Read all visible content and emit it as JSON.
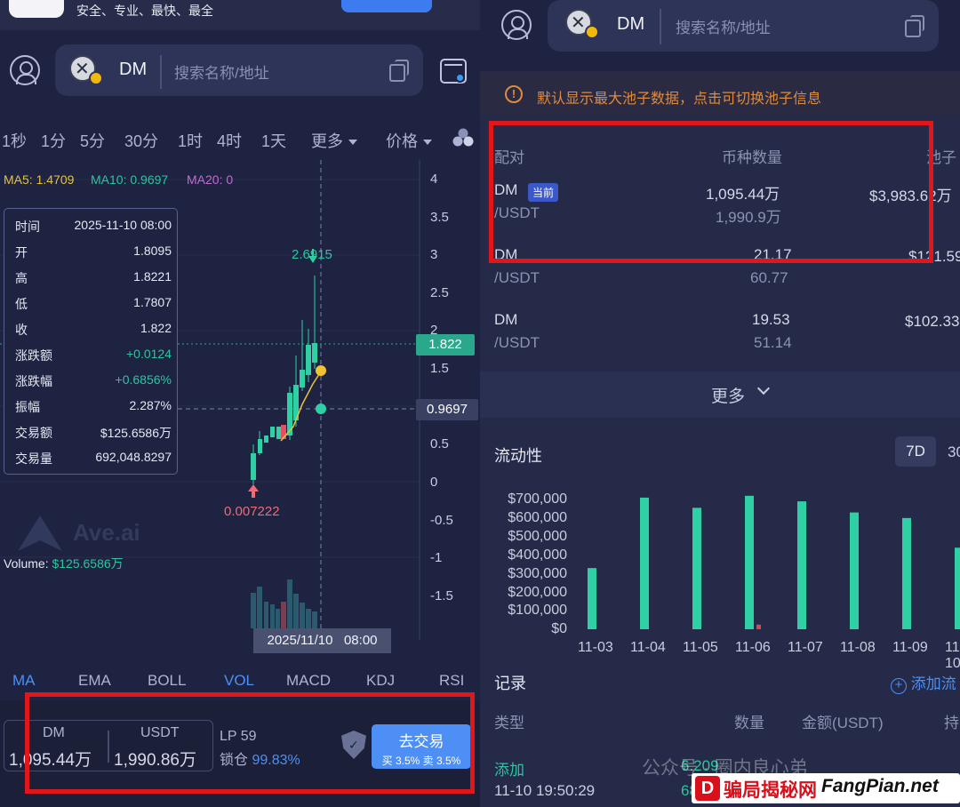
{
  "left": {
    "tagline": "安全、专业、最快、最全",
    "search": {
      "symbol": "DM",
      "placeholder": "搜索名称/地址"
    },
    "timeframes": [
      "1秒",
      "1分",
      "5分",
      "30分",
      "1时",
      "4时",
      "1天"
    ],
    "more_label": "更多",
    "price_label": "价格",
    "ma": {
      "ma5": "MA5: 1.4709",
      "ma10": "MA10: 0.9697",
      "ma20": "MA20: 0"
    },
    "y_axis": [
      "4",
      "3.5",
      "3",
      "2.5",
      "2",
      "1.5",
      "1",
      "0.5",
      "0",
      "-0.5",
      "-1",
      "-1.5"
    ],
    "tooltip": [
      {
        "k": "时间",
        "v": "2025-11-10 08:00"
      },
      {
        "k": "开",
        "v": "1.8095"
      },
      {
        "k": "高",
        "v": "1.8221"
      },
      {
        "k": "低",
        "v": "1.7807"
      },
      {
        "k": "收",
        "v": "1.822"
      },
      {
        "k": "涨跌额",
        "v": "+0.0124"
      },
      {
        "k": "涨跌幅",
        "v": "+0.6856%"
      },
      {
        "k": "振幅",
        "v": "2.287%"
      },
      {
        "k": "交易额",
        "v": "$125.6586万"
      },
      {
        "k": "交易量",
        "v": "692,048.8297"
      }
    ],
    "high_marker": "2.6915",
    "low_marker": "0.007222",
    "price_current": "1.822",
    "price_ma": "0.9697",
    "volume_label": "Volume:",
    "volume_value": "$125.6586万",
    "watermark": "Ave.ai",
    "crosshair_date": "2025/11/10",
    "crosshair_time": "08:00",
    "indicators": [
      "MA",
      "EMA",
      "BOLL",
      "VOL",
      "MACD",
      "KDJ",
      "RSI"
    ],
    "pair": {
      "base": "DM",
      "quote": "USDT",
      "base_amount": "1,095.44万",
      "quote_amount": "1,990.86万"
    },
    "lp": {
      "label": "LP 59",
      "lock_label": "锁仓",
      "lock_value": "99.83%"
    },
    "trade": {
      "label": "去交易",
      "fees": "买 3.5% 卖 3.5%"
    }
  },
  "right": {
    "search": {
      "symbol": "DM",
      "placeholder": "搜索名称/地址"
    },
    "notice": "默认显示最大池子数据，点击可切换池子信息",
    "table": {
      "headers": [
        "配对",
        "币种数量",
        "池子"
      ],
      "rows": [
        {
          "base": "DM",
          "badge": "当前",
          "quote": "/USDT",
          "amount1": "1,095.44万",
          "amount2": "1,990.9万",
          "pool": "$3,983.62万"
        },
        {
          "base": "DM",
          "badge": "",
          "quote": "/USDT",
          "amount1": "21.17",
          "amount2": "60.77",
          "pool": "$121.59"
        },
        {
          "base": "DM",
          "badge": "",
          "quote": "/USDT",
          "amount1": "19.53",
          "amount2": "51.14",
          "pool": "$102.33"
        }
      ]
    },
    "more_label": "更多",
    "liquidity_title": "流动性",
    "range_active": "7D",
    "range_other": "30",
    "records_title": "记录",
    "add_link": "添加流",
    "rec_headers": [
      "类型",
      "数量",
      "金额(USDT)",
      "持"
    ],
    "rec_row": {
      "type": "添加",
      "amount": "6.209",
      "time": "11-10 19:50:29",
      "amount2": "68"
    }
  },
  "chart_data": {
    "type": "bar",
    "title": "流动性",
    "categories": [
      "11-03",
      "11-04",
      "11-05",
      "11-06",
      "11-07",
      "11-08",
      "11-09",
      "11-10"
    ],
    "series": [
      {
        "name": "add",
        "color": "#2fd0a4",
        "values": [
          330000,
          710000,
          655000,
          720000,
          690000,
          630000,
          600000,
          440000
        ]
      },
      {
        "name": "remove",
        "color": "#e0454f",
        "values": [
          0,
          0,
          0,
          25000,
          0,
          0,
          0,
          0
        ]
      }
    ],
    "y_ticks": [
      "$0",
      "$100,000",
      "$200,000",
      "$300,000",
      "$400,000",
      "$500,000",
      "$600,000",
      "$700,000"
    ],
    "ylim": [
      0,
      700000
    ]
  },
  "watermark": {
    "wechat": "公众号 · 圈内良心弟",
    "site_cn": "骗局揭秘网",
    "site": "FangPian.net"
  }
}
